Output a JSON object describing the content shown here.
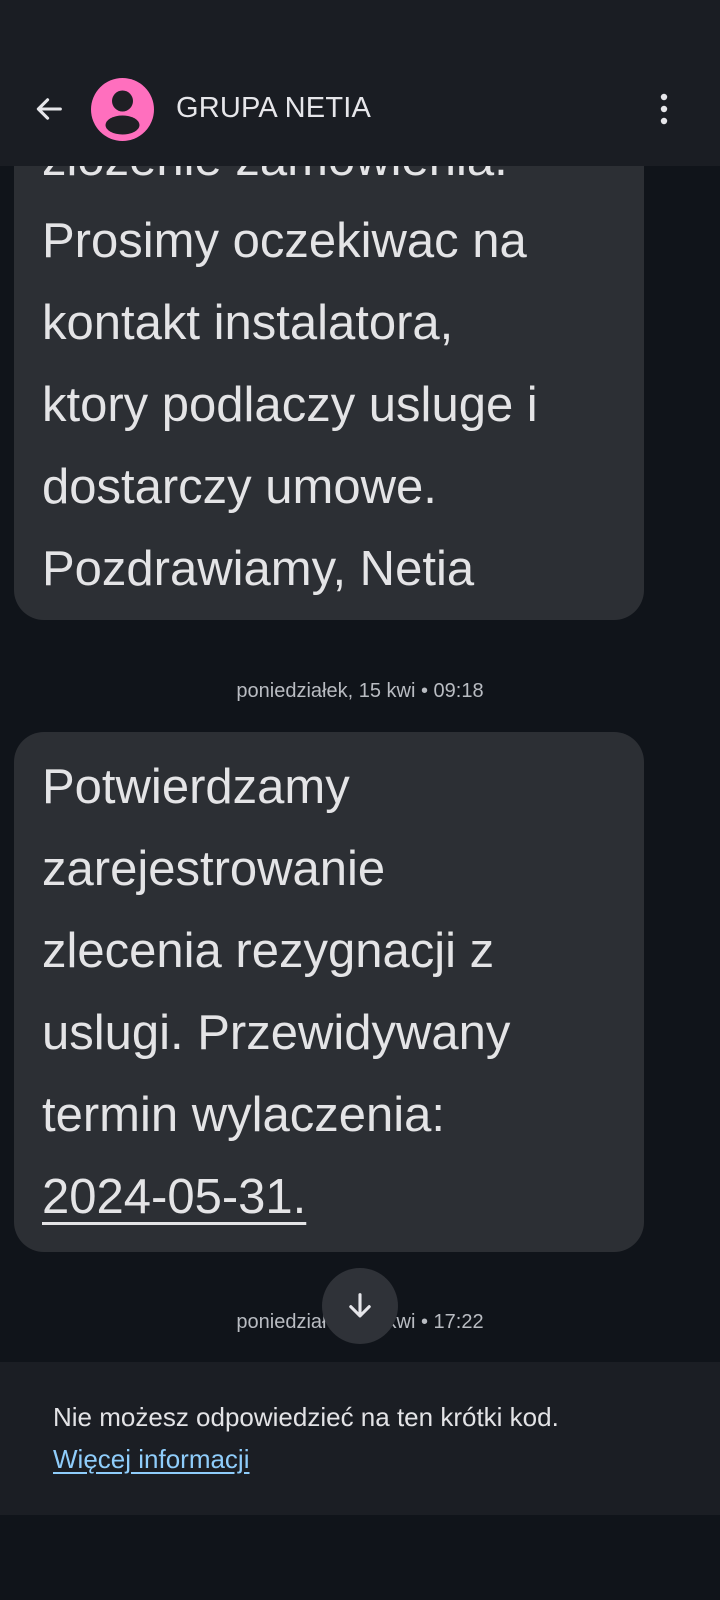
{
  "header": {
    "title": "GRUPA NETIA",
    "back_icon": "arrow-left-icon",
    "avatar_icon": "person-icon",
    "menu_icon": "more-vertical-icon",
    "avatar_color": "#ff6fbe"
  },
  "messages": [
    {
      "lines": [
        "zlozenie zamowienia.",
        "Prosimy oczekiwac na",
        "kontakt instalatora,",
        "ktory podlaczy usluge i",
        "dostarczy umowe.",
        "Pozdrawiamy, Netia"
      ]
    },
    {
      "lines": [
        "Potwierdzamy",
        "zarejestrowanie",
        "zlecenia rezygnacji z",
        "uslugi. Przewidywany",
        "termin wylaczenia:"
      ],
      "link": "2024-05-31."
    }
  ],
  "timestamps": [
    "poniedziałek, 15 kwi • 09:18",
    "poniedziałek, 15 kwi • 17:22"
  ],
  "scroll_button_icon": "arrow-down-icon",
  "footer": {
    "notice": "Nie możesz odpowiedzieć na ten krótki kod.",
    "link": "Więcej informacji"
  },
  "colors": {
    "background": "#10141a",
    "bubble": "#2c2f34",
    "bar": "#1a1d23",
    "link": "#8fcdfb"
  }
}
